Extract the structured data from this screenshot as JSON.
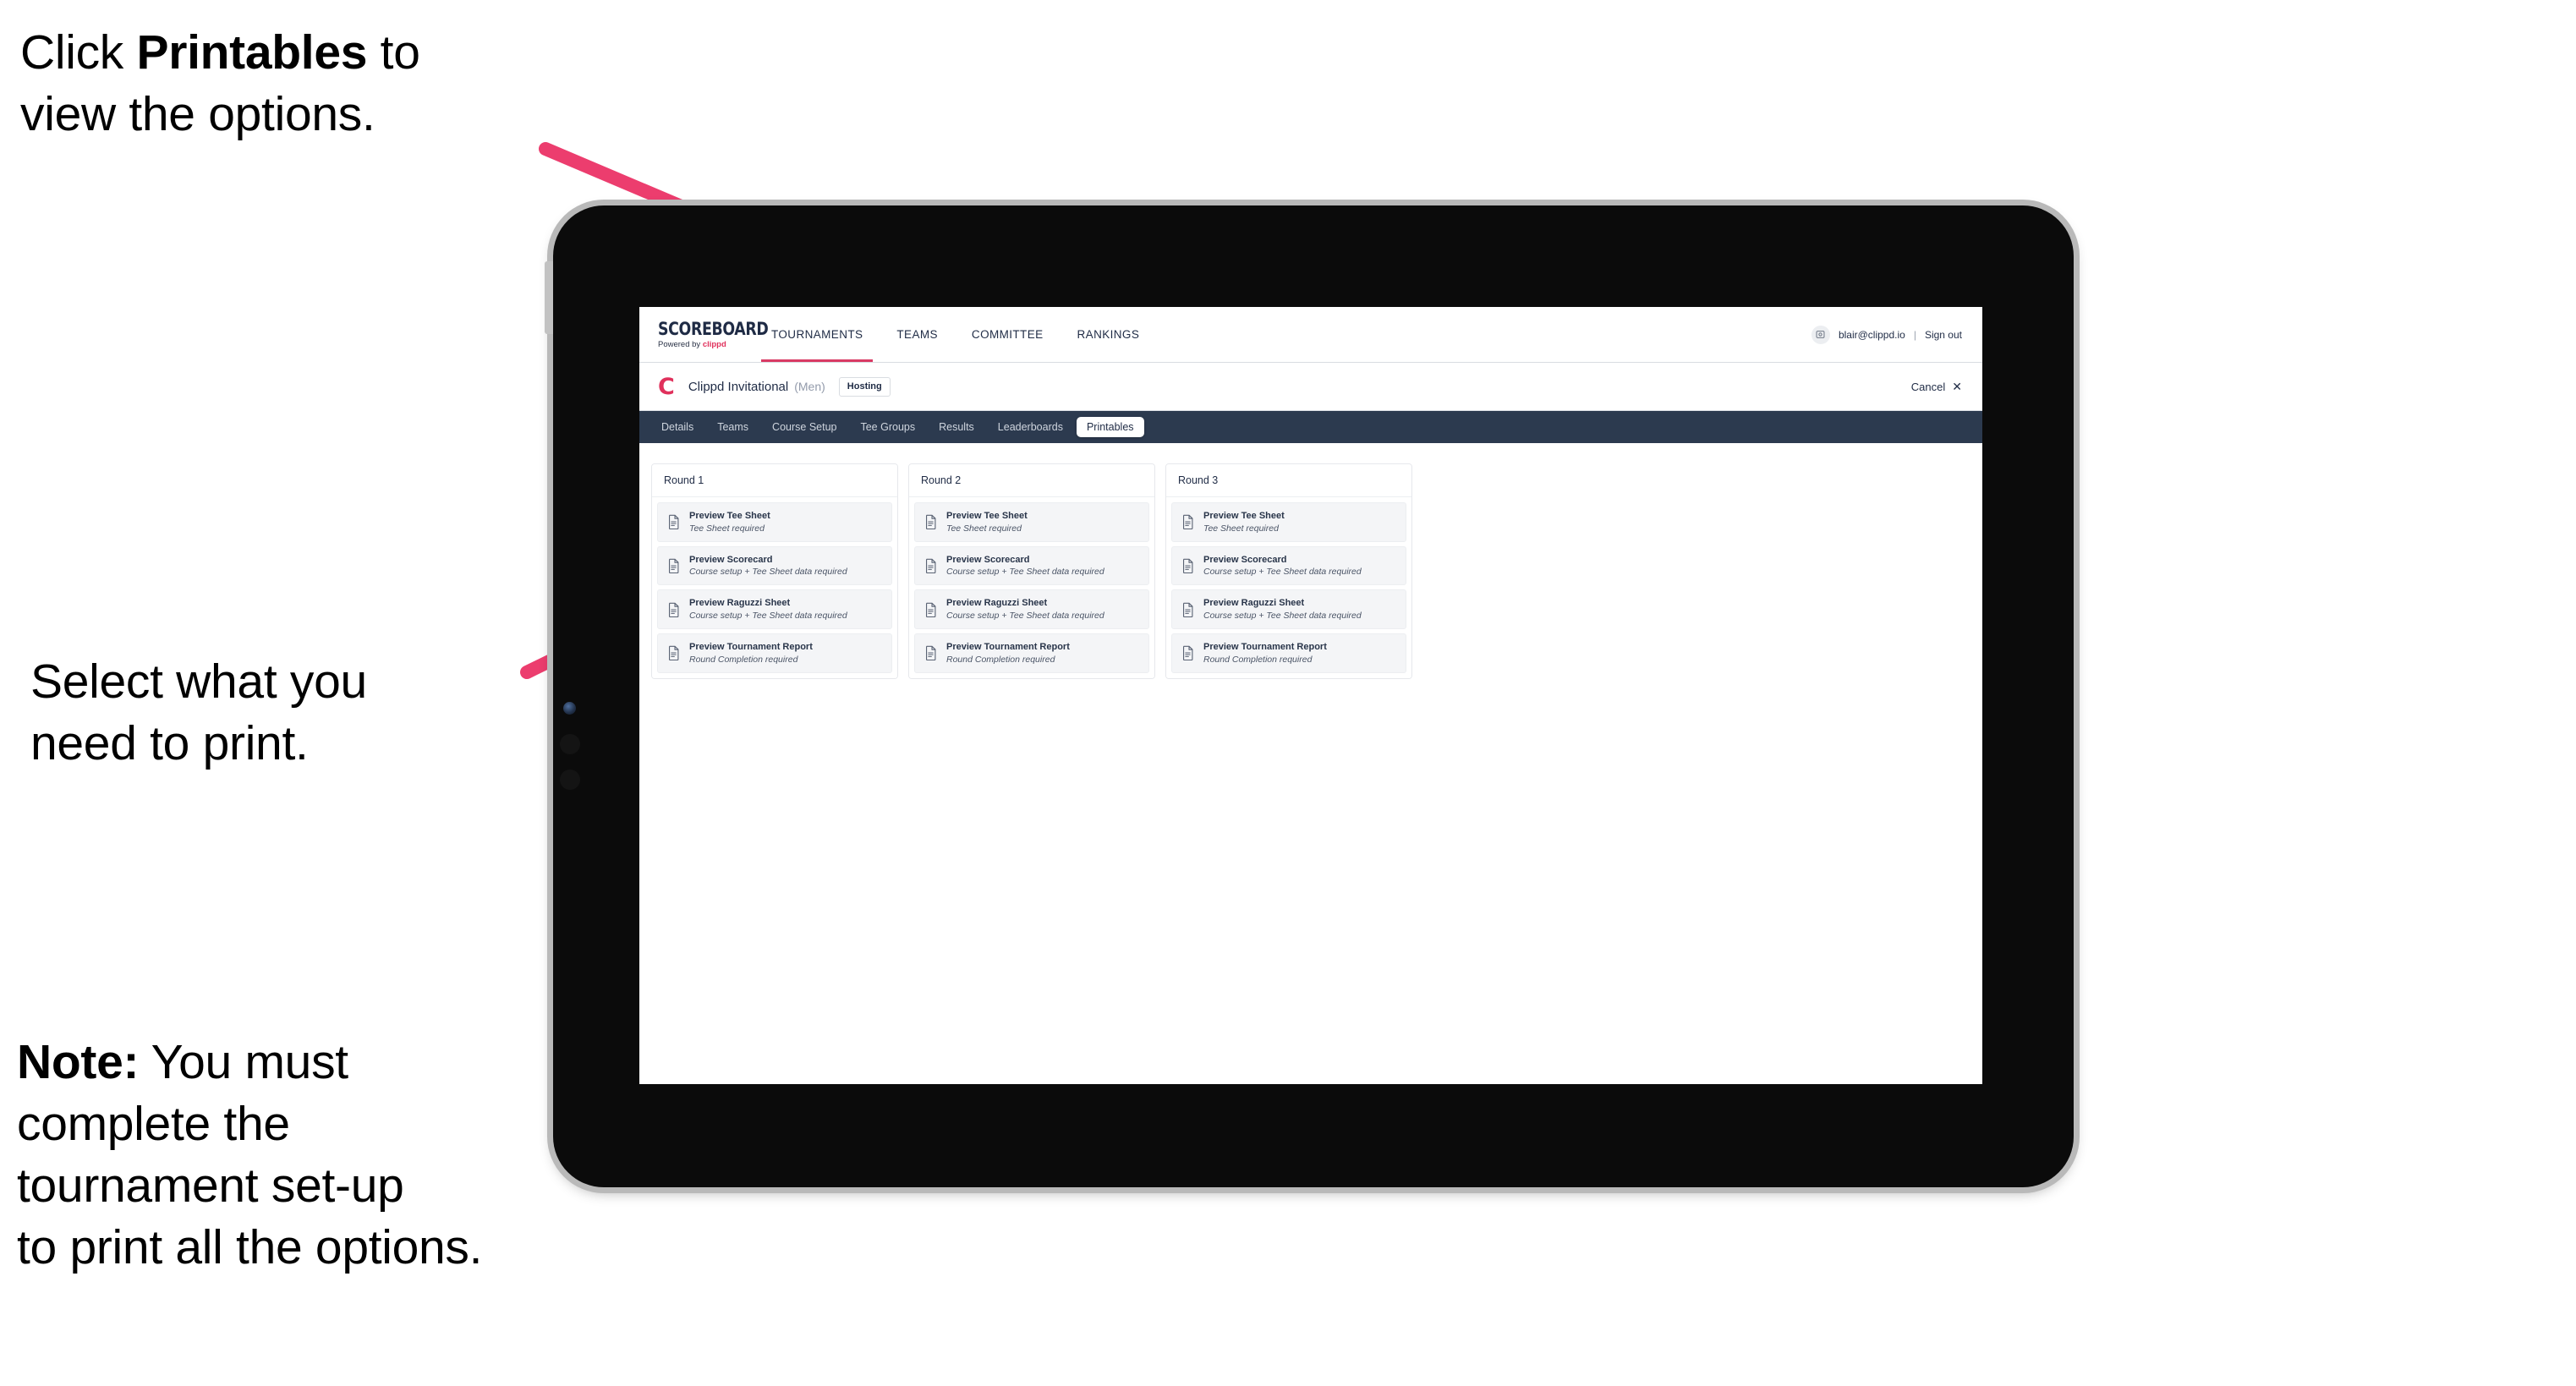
{
  "annotations": [
    {
      "id": "ann-1",
      "prefix": "Click ",
      "bold": "Printables",
      "suffix": " to\nview the options."
    },
    {
      "id": "ann-2",
      "prefix": "",
      "bold": "",
      "suffix": "Select what you\n need to print."
    },
    {
      "id": "ann-3",
      "prefix": "",
      "bold": "Note:",
      "suffix": " You must\ncomplete the\ntournament set-up\nto print all the options."
    }
  ],
  "colors": {
    "arrow": "#ec3d6e",
    "brand_accent": "#e0315c",
    "tab_strip": "#2c3a4f",
    "active_underline": "#d93a64",
    "device_body": "#0b0b0b",
    "device_frame": "#b9b9b9"
  },
  "app": {
    "brand": {
      "title": "SCOREBOARD",
      "powered_prefix": "Powered by ",
      "powered_accent": "clippd"
    },
    "top_nav": [
      {
        "label": "TOURNAMENTS",
        "active": true
      },
      {
        "label": "TEAMS",
        "active": false
      },
      {
        "label": "COMMITTEE",
        "active": false
      },
      {
        "label": "RANKINGS",
        "active": false
      }
    ],
    "account": {
      "avatar_icon": "user-avatar-icon",
      "email": "blair@clippd.io",
      "separator": "|",
      "sign_out": "Sign out"
    },
    "tournament": {
      "logo_letter": "C",
      "name": "Clippd Invitational",
      "gender": "(Men)",
      "status_badge": "Hosting",
      "cancel_label": "Cancel",
      "cancel_icon": "close-icon"
    },
    "tabs": [
      {
        "label": "Details",
        "active": false
      },
      {
        "label": "Teams",
        "active": false
      },
      {
        "label": "Course Setup",
        "active": false
      },
      {
        "label": "Tee Groups",
        "active": false
      },
      {
        "label": "Results",
        "active": false
      },
      {
        "label": "Leaderboards",
        "active": false
      },
      {
        "label": "Printables",
        "active": true
      }
    ],
    "rounds": [
      {
        "title": "Round 1",
        "items": [
          {
            "title": "Preview Tee Sheet",
            "sub": "Tee Sheet required"
          },
          {
            "title": "Preview Scorecard",
            "sub": "Course setup + Tee Sheet data required"
          },
          {
            "title": "Preview Raguzzi Sheet",
            "sub": "Course setup + Tee Sheet data required"
          },
          {
            "title": "Preview Tournament Report",
            "sub": "Round Completion required"
          }
        ]
      },
      {
        "title": "Round 2",
        "items": [
          {
            "title": "Preview Tee Sheet",
            "sub": "Tee Sheet required"
          },
          {
            "title": "Preview Scorecard",
            "sub": "Course setup + Tee Sheet data required"
          },
          {
            "title": "Preview Raguzzi Sheet",
            "sub": "Course setup + Tee Sheet data required"
          },
          {
            "title": "Preview Tournament Report",
            "sub": "Round Completion required"
          }
        ]
      },
      {
        "title": "Round 3",
        "items": [
          {
            "title": "Preview Tee Sheet",
            "sub": "Tee Sheet required"
          },
          {
            "title": "Preview Scorecard",
            "sub": "Course setup + Tee Sheet data required"
          },
          {
            "title": "Preview Raguzzi Sheet",
            "sub": "Course setup + Tee Sheet data required"
          },
          {
            "title": "Preview Tournament Report",
            "sub": "Round Completion required"
          }
        ]
      }
    ]
  }
}
